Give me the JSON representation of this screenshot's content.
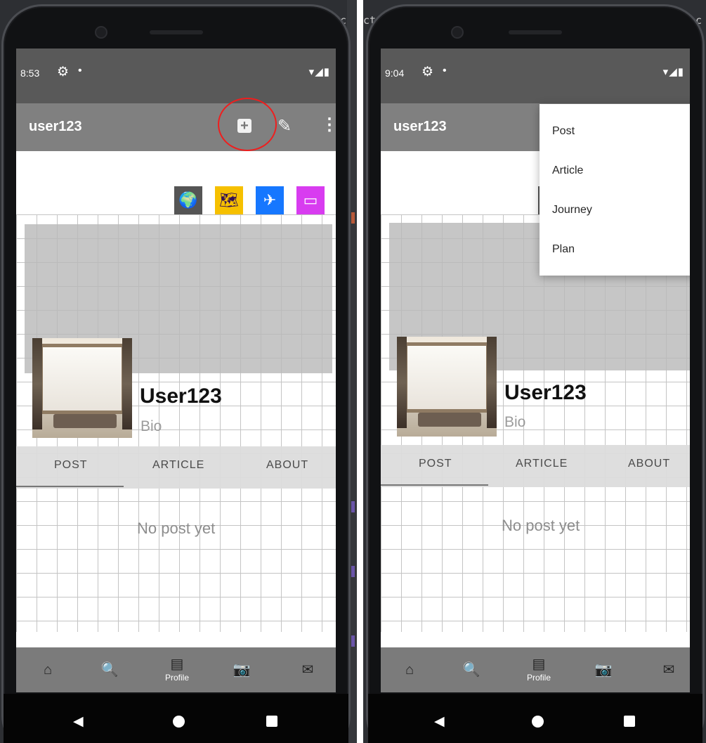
{
  "left": {
    "status": {
      "time": "8:53"
    },
    "appbar": {
      "title": "user123",
      "add_label": "+",
      "edit_icon": "edit-square-icon",
      "menu_icon": "more-vertical-icon"
    },
    "quick_icons": [
      "globe-icon",
      "map-route-icon",
      "flight-icon",
      "bookmark-icon"
    ],
    "profile": {
      "display_name": "User123",
      "bio": "Bio"
    },
    "tabs": [
      "POST",
      "ARTICLE",
      "ABOUT"
    ],
    "empty_message": "No post yet",
    "bottom_nav": [
      {
        "icon": "home-icon"
      },
      {
        "icon": "search-icon"
      },
      {
        "icon": "profile-document-icon",
        "label": "Profile"
      },
      {
        "icon": "camera-icon"
      },
      {
        "icon": "mail-icon"
      }
    ],
    "annotations": {
      "highlight": "add-button"
    }
  },
  "right": {
    "status": {
      "time": "9:04"
    },
    "appbar": {
      "title": "user123"
    },
    "profile": {
      "display_name": "User123",
      "bio": "Bio"
    },
    "tabs": [
      "POST",
      "ARTICLE",
      "ABOUT"
    ],
    "empty_message": "No post yet",
    "bottom_nav": [
      {
        "icon": "home-icon"
      },
      {
        "icon": "search-icon"
      },
      {
        "icon": "profile-document-icon",
        "label": "Profile"
      },
      {
        "icon": "camera-icon"
      },
      {
        "icon": "mail-icon"
      }
    ],
    "menu": [
      "Post",
      "Article",
      "Journey",
      "Plan"
    ]
  },
  "ide": {
    "left_fragment": "cti",
    "right_fragment": "c"
  },
  "colors": {
    "appbar": "#808080",
    "statusbar": "#595959",
    "tab_background": "#dcdcdc",
    "highlight": "#ef1e1e",
    "globe_icon_bg": "#555555",
    "map_icon_bg": "#f6c000",
    "flight_icon_bg": "#1677ff",
    "bookmark_icon_bg": "#d83cf0"
  }
}
